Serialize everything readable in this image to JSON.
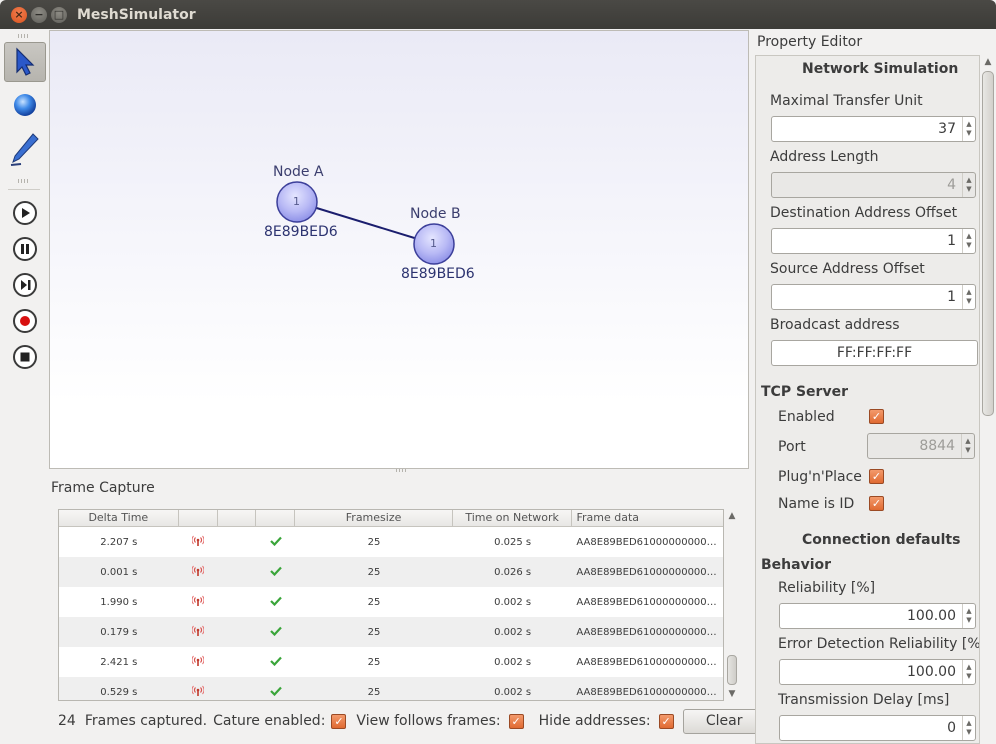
{
  "window": {
    "title": "MeshSimulator"
  },
  "toolbar": {
    "tools": [
      {
        "name": "select-tool",
        "icon": "arrow-pointer-icon"
      },
      {
        "name": "add-node-tool",
        "icon": "sphere-icon"
      },
      {
        "name": "draw-link-tool",
        "icon": "pen-icon"
      }
    ],
    "controls": [
      {
        "name": "play-button",
        "icon": "play-icon"
      },
      {
        "name": "pause-button",
        "icon": "pause-icon"
      },
      {
        "name": "step-button",
        "icon": "step-forward-icon"
      },
      {
        "name": "record-button",
        "icon": "record-icon"
      },
      {
        "name": "stop-button",
        "icon": "stop-icon"
      }
    ]
  },
  "canvas": {
    "nodes": [
      {
        "label": "Node A",
        "badge": "1",
        "id": "8E89BED6"
      },
      {
        "label": "Node B",
        "badge": "1",
        "id": "8E89BED6"
      }
    ],
    "colors": {
      "node_fill": "#b8b9f5",
      "link": "#1b1e6e"
    }
  },
  "frame_capture": {
    "title": "Frame Capture",
    "columns": [
      "Delta Time",
      "",
      "",
      "",
      "Framesize",
      "Time on Network",
      "Frame data"
    ],
    "rows": [
      {
        "delta": "2.207 s",
        "size": "25",
        "ton": "0.025 s",
        "data": "AA8E89BED61000000000000000000..."
      },
      {
        "delta": "0.001 s",
        "size": "25",
        "ton": "0.026 s",
        "data": "AA8E89BED61000000000000000000..."
      },
      {
        "delta": "1.990 s",
        "size": "25",
        "ton": "0.002 s",
        "data": "AA8E89BED61000000000000000000..."
      },
      {
        "delta": "0.179 s",
        "size": "25",
        "ton": "0.002 s",
        "data": "AA8E89BED61000000000000000000..."
      },
      {
        "delta": "2.421 s",
        "size": "25",
        "ton": "0.002 s",
        "data": "AA8E89BED61000000000000000000..."
      },
      {
        "delta": "0.529 s",
        "size": "25",
        "ton": "0.002 s",
        "data": "AA8E89BED61000000000000000000..."
      }
    ],
    "status": {
      "count": "24",
      "frames_captured": "Frames captured.",
      "capture_enabled": "Cature enabled:",
      "view_follows": "View follows frames:",
      "hide_addresses": "Hide addresses:",
      "clear": "Clear"
    }
  },
  "property_editor": {
    "title": "Property Editor",
    "network": {
      "section": "Network Simulation",
      "mtu_label": "Maximal Transfer Unit",
      "mtu": "37",
      "addr_len_label": "Address Length",
      "addr_len": "4",
      "dest_off_label": "Destination Address Offset",
      "dest_off": "1",
      "src_off_label": "Source Address Offset",
      "src_off": "1",
      "broadcast_label": "Broadcast address",
      "broadcast": "FF:FF:FF:FF"
    },
    "tcp": {
      "section": "TCP Server",
      "enabled_label": "Enabled",
      "port_label": "Port",
      "port": "8844",
      "plug_label": "Plug'n'Place",
      "nameid_label": "Name is ID"
    },
    "connection": {
      "section": "Connection defaults",
      "behavior": "Behavior",
      "reliability_label": "Reliability [%]",
      "reliability": "100.00",
      "edr_label": "Error Detection Reliability [%]",
      "edr": "100.00",
      "delay_label": "Transmission Delay [ms]",
      "delay": "0"
    }
  }
}
